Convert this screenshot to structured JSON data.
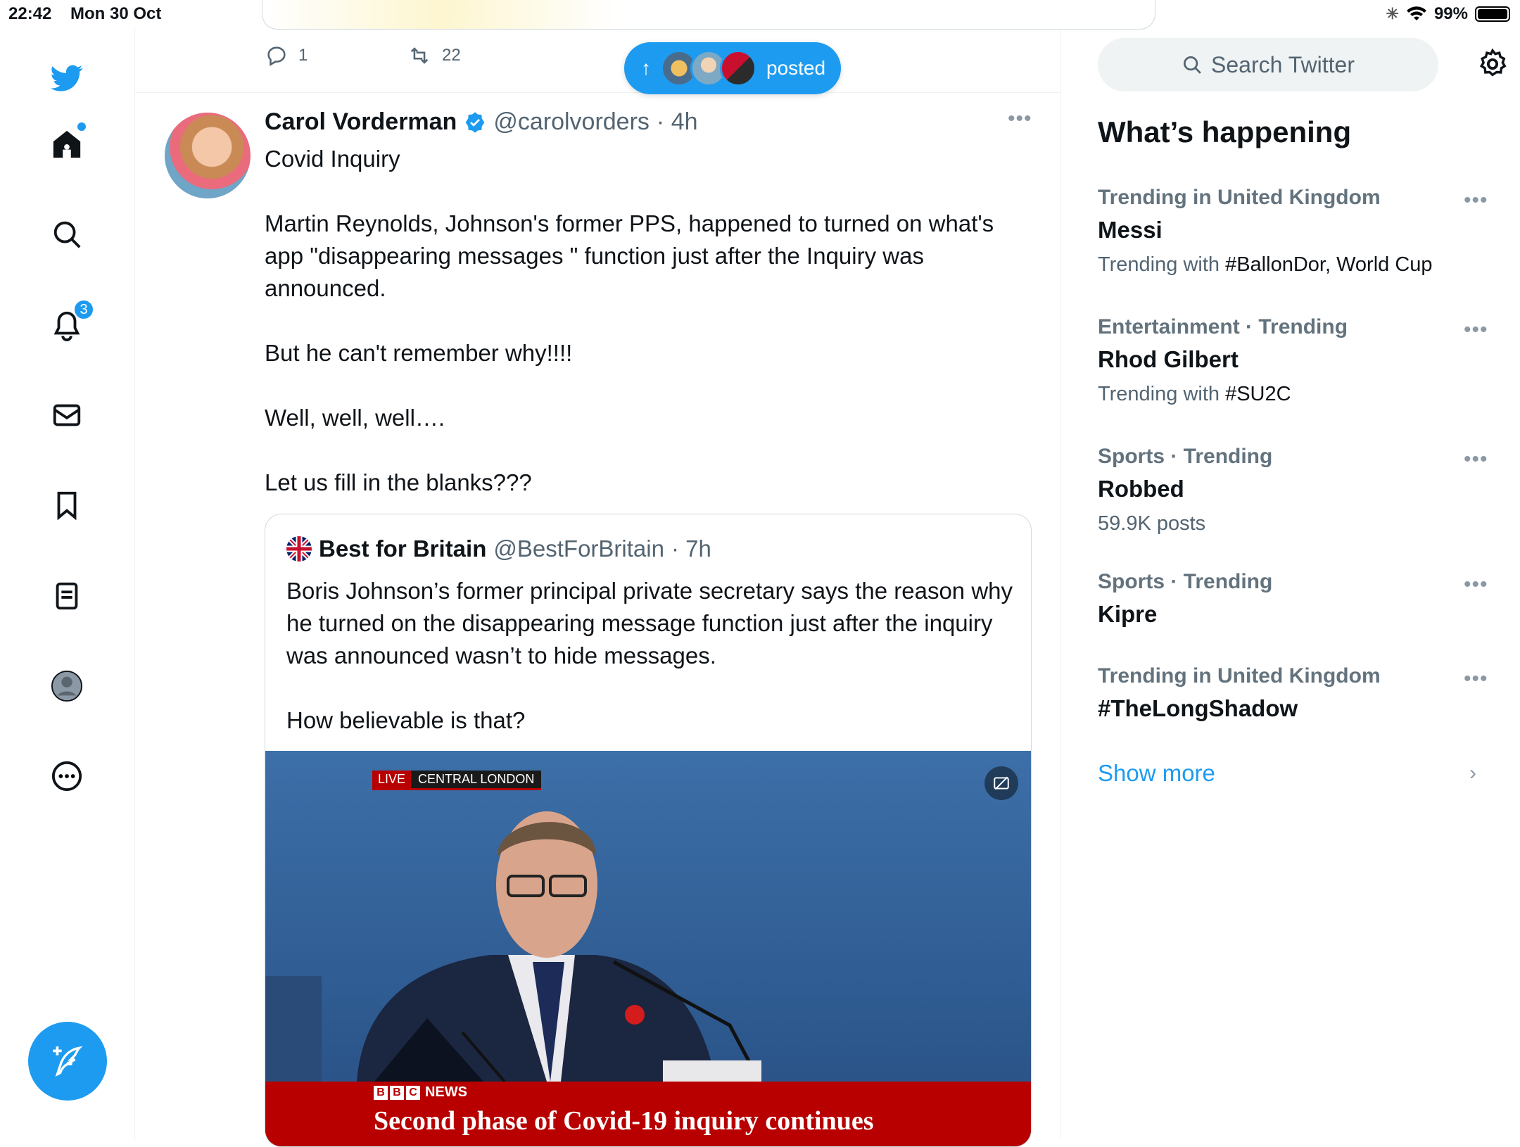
{
  "status_bar": {
    "time": "22:42",
    "date": "Mon 30 Oct",
    "battery": "99%"
  },
  "sidebar": {
    "notifications_count": "3"
  },
  "previous_tweet": {
    "reply_count": "1",
    "retweet_count": "22"
  },
  "new_posts_pill": {
    "label": "posted"
  },
  "tweet": {
    "name": "Carol Vorderman",
    "handle": "@carolvorders",
    "time": "· 4h",
    "text": "Covid Inquiry\n\nMartin Reynolds, Johnson's former PPS, happened to turned on what's app \"disappearing messages \" function just after the Inquiry was announced.\n\nBut he can't remember why!!!!\n\nWell, well, well….\n\nLet us fill in the blanks???"
  },
  "quote": {
    "name": "Best for Britain",
    "handle": "@BestForBritain",
    "time": "· 7h",
    "text": "Boris Johnson’s former principal private secretary says the reason why he turned on the disappearing message function just after the inquiry was announced wasn’t to hide messages.\n\nHow believable is that?",
    "media": {
      "live_label": "LIVE",
      "location_label": "CENTRAL LONDON",
      "bbc_letters": [
        "B",
        "B",
        "C"
      ],
      "news_label": "NEWS",
      "headline": "Second phase of Covid-19 inquiry continues"
    }
  },
  "right": {
    "search_placeholder": "Search Twitter",
    "section_title": "What’s happening",
    "trends": [
      {
        "context": "Trending in United Kingdom",
        "topic": "Messi",
        "meta_prefix": "Trending with ",
        "meta_tags": "#BallonDor, World Cup"
      },
      {
        "context": "Entertainment · Trending",
        "topic": "Rhod Gilbert",
        "meta_prefix": "Trending with ",
        "meta_tags": "#SU2C"
      },
      {
        "context": "Sports · Trending",
        "topic": "Robbed",
        "meta_prefix": "59.9K posts",
        "meta_tags": ""
      },
      {
        "context": "Sports · Trending",
        "topic": "Kipre",
        "meta_prefix": "",
        "meta_tags": ""
      },
      {
        "context": "Trending in United Kingdom",
        "topic": "#TheLongShadow",
        "meta_prefix": "",
        "meta_tags": ""
      }
    ],
    "show_more": "Show more"
  },
  "colors": {
    "accent": "#1d9bf0",
    "bbc_red": "#b80000"
  }
}
